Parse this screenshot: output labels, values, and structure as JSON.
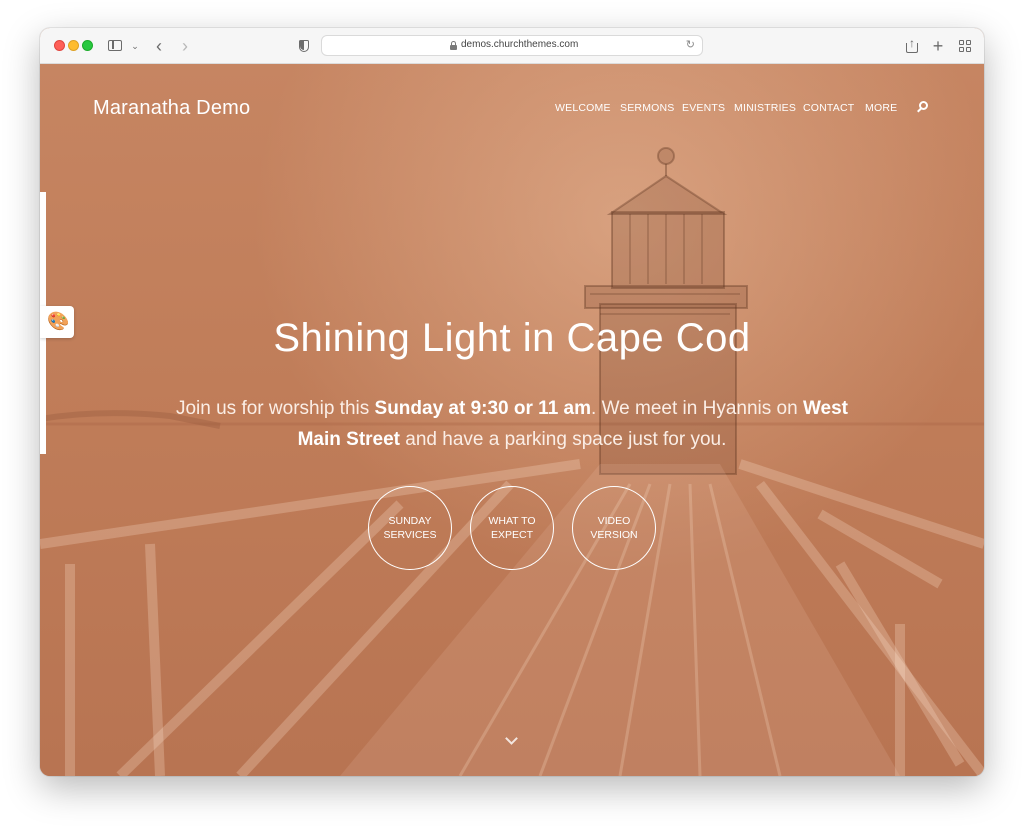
{
  "browser": {
    "url": "demos.churchthemes.com"
  },
  "site": {
    "title": "Maranatha Demo",
    "nav": [
      "WELCOME",
      "SERMONS",
      "EVENTS",
      "MINISTRIES",
      "CONTACT",
      "MORE"
    ]
  },
  "hero": {
    "title": "Shining Light in Cape Cod",
    "text": {
      "part1": "Join us for worship this ",
      "bold1": "Sunday at 9:30 or 11 am",
      "part2": ". We meet in Hyannis on ",
      "bold2": "West Main Street",
      "part3": " and have a parking space just for you."
    },
    "buttons": [
      {
        "line1": "SUNDAY",
        "line2": "SERVICES"
      },
      {
        "line1": "WHAT TO",
        "line2": "EXPECT"
      },
      {
        "line1": "VIDEO",
        "line2": "VERSION"
      }
    ]
  },
  "colors": {
    "overlay": "#c07d59",
    "text": "#ffffff"
  }
}
